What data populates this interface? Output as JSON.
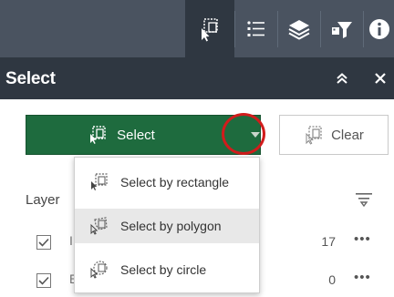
{
  "toolbar": {
    "buttons": [
      {
        "icon": "select-tool-icon",
        "active": true
      },
      {
        "icon": "legend-icon",
        "active": false
      },
      {
        "icon": "layers-icon",
        "active": false
      },
      {
        "icon": "filter-icon",
        "active": false
      },
      {
        "icon": "info-icon",
        "active": false
      }
    ]
  },
  "panel": {
    "title": "Select",
    "collapse_icon": "double-chevron-up-icon",
    "close_icon": "close-icon"
  },
  "actions": {
    "select_label": "Select",
    "clear_label": "Clear"
  },
  "dropdown": {
    "items": [
      {
        "label": "Select by rectangle",
        "icon": "rectangle-select-icon"
      },
      {
        "label": "Select by polygon",
        "icon": "polygon-select-icon"
      },
      {
        "label": "Select by circle",
        "icon": "circle-select-icon"
      }
    ],
    "hovered_index": 1
  },
  "layers": {
    "label": "Layer",
    "rows": [
      {
        "name": "I",
        "count": "17",
        "checked": true
      },
      {
        "name": "E",
        "count": "0",
        "checked": true
      }
    ]
  },
  "colors": {
    "toolbar_bg": "#4a5360",
    "header_bg": "#2f3741",
    "select_button": "#1e6b3e",
    "highlight_circle": "#d11c1c"
  }
}
